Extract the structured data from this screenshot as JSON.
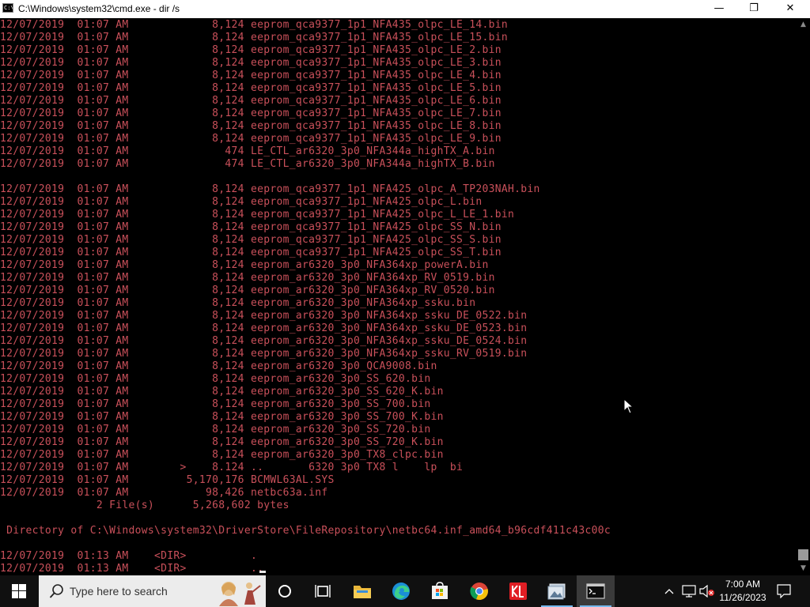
{
  "window": {
    "title": "C:\\Windows\\system32\\cmd.exe - dir /s",
    "icon_text": "C:\\",
    "minimize_glyph": "—",
    "maximize_glyph": "❐",
    "close_glyph": "✕"
  },
  "console": {
    "text_color": "#c9505a",
    "lines": [
      "12/07/2019  01:07 AM             8,124 eeprom_qca9377_1p1_NFA435_olpc_LE_14.bin",
      "12/07/2019  01:07 AM             8,124 eeprom_qca9377_1p1_NFA435_olpc_LE_15.bin",
      "12/07/2019  01:07 AM             8,124 eeprom_qca9377_1p1_NFA435_olpc_LE_2.bin",
      "12/07/2019  01:07 AM             8,124 eeprom_qca9377_1p1_NFA435_olpc_LE_3.bin",
      "12/07/2019  01:07 AM             8,124 eeprom_qca9377_1p1_NFA435_olpc_LE_4.bin",
      "12/07/2019  01:07 AM             8,124 eeprom_qca9377_1p1_NFA435_olpc_LE_5.bin",
      "12/07/2019  01:07 AM             8,124 eeprom_qca9377_1p1_NFA435_olpc_LE_6.bin",
      "12/07/2019  01:07 AM             8,124 eeprom_qca9377_1p1_NFA435_olpc_LE_7.bin",
      "12/07/2019  01:07 AM             8,124 eeprom_qca9377_1p1_NFA435_olpc_LE_8.bin",
      "12/07/2019  01:07 AM             8,124 eeprom_qca9377_1p1_NFA435_olpc_LE_9.bin",
      "12/07/2019  01:07 AM               474 LE_CTL_ar6320_3p0_NFA344a_highTX_A.bin",
      "12/07/2019  01:07 AM               474 LE_CTL_ar6320_3p0_NFA344a_highTX_B.bin",
      "",
      "12/07/2019  01:07 AM             8,124 eeprom_qca9377_1p1_NFA425_olpc_A_TP203NAH.bin",
      "12/07/2019  01:07 AM             8,124 eeprom_qca9377_1p1_NFA425_olpc_L.bin",
      "12/07/2019  01:07 AM             8,124 eeprom_qca9377_1p1_NFA425_olpc_L_LE_1.bin",
      "12/07/2019  01:07 AM             8,124 eeprom_qca9377_1p1_NFA425_olpc_SS_N.bin",
      "12/07/2019  01:07 AM             8,124 eeprom_qca9377_1p1_NFA425_olpc_SS_S.bin",
      "12/07/2019  01:07 AM             8,124 eeprom_qca9377_1p1_NFA425_olpc_SS_T.bin",
      "12/07/2019  01:07 AM             8,124 eeprom_ar6320_3p0_NFA364xp_powerA.bin",
      "12/07/2019  01:07 AM             8,124 eeprom_ar6320_3p0_NFA364xp_RV_0519.bin",
      "12/07/2019  01:07 AM             8,124 eeprom_ar6320_3p0_NFA364xp_RV_0520.bin",
      "12/07/2019  01:07 AM             8,124 eeprom_ar6320_3p0_NFA364xp_ssku.bin",
      "12/07/2019  01:07 AM             8,124 eeprom_ar6320_3p0_NFA364xp_ssku_DE_0522.bin",
      "12/07/2019  01:07 AM             8,124 eeprom_ar6320_3p0_NFA364xp_ssku_DE_0523.bin",
      "12/07/2019  01:07 AM             8,124 eeprom_ar6320_3p0_NFA364xp_ssku_DE_0524.bin",
      "12/07/2019  01:07 AM             8,124 eeprom_ar6320_3p0_NFA364xp_ssku_RV_0519.bin",
      "12/07/2019  01:07 AM             8,124 eeprom_ar6320_3p0_QCA9008.bin",
      "12/07/2019  01:07 AM             8,124 eeprom_ar6320_3p0_SS_620.bin",
      "12/07/2019  01:07 AM             8,124 eeprom_ar6320_3p0_SS_620_K.bin",
      "12/07/2019  01:07 AM             8,124 eeprom_ar6320_3p0_SS_700.bin",
      "12/07/2019  01:07 AM             8,124 eeprom_ar6320_3p0_SS_700_K.bin",
      "12/07/2019  01:07 AM             8,124 eeprom_ar6320_3p0_SS_720.bin",
      "12/07/2019  01:07 AM             8,124 eeprom_ar6320_3p0_SS_720_K.bin",
      "12/07/2019  01:07 AM             8,124 eeprom_ar6320_3p0_TX8_clpc.bin",
      "12/07/2019  01:07 AM        >    8.124 ..       6320 3p0 TX8 l    lp  bi",
      "12/07/2019  01:07 AM         5,170,176 BCMWL63AL.SYS",
      "12/07/2019  01:07 AM            98,426 netbc63a.inf",
      "               2 File(s)      5,268,602 bytes",
      "",
      " Directory of C:\\Windows\\system32\\DriverStore\\FileRepository\\netbc64.inf_amd64_b96cdf411c43c00c",
      "",
      "12/07/2019  01:13 AM    <DIR>          .",
      "12/07/2019  01:13 AM    <DIR>          .."
    ]
  },
  "taskbar": {
    "search_placeholder": "Type here to search",
    "apps": [
      "task-view",
      "file-explorer",
      "edge",
      "store",
      "chrome",
      "red-app",
      "image-app",
      "command-prompt"
    ],
    "accent": "#76b9ed",
    "clock": {
      "time": "7:00 AM",
      "date": "11/26/2023"
    }
  }
}
